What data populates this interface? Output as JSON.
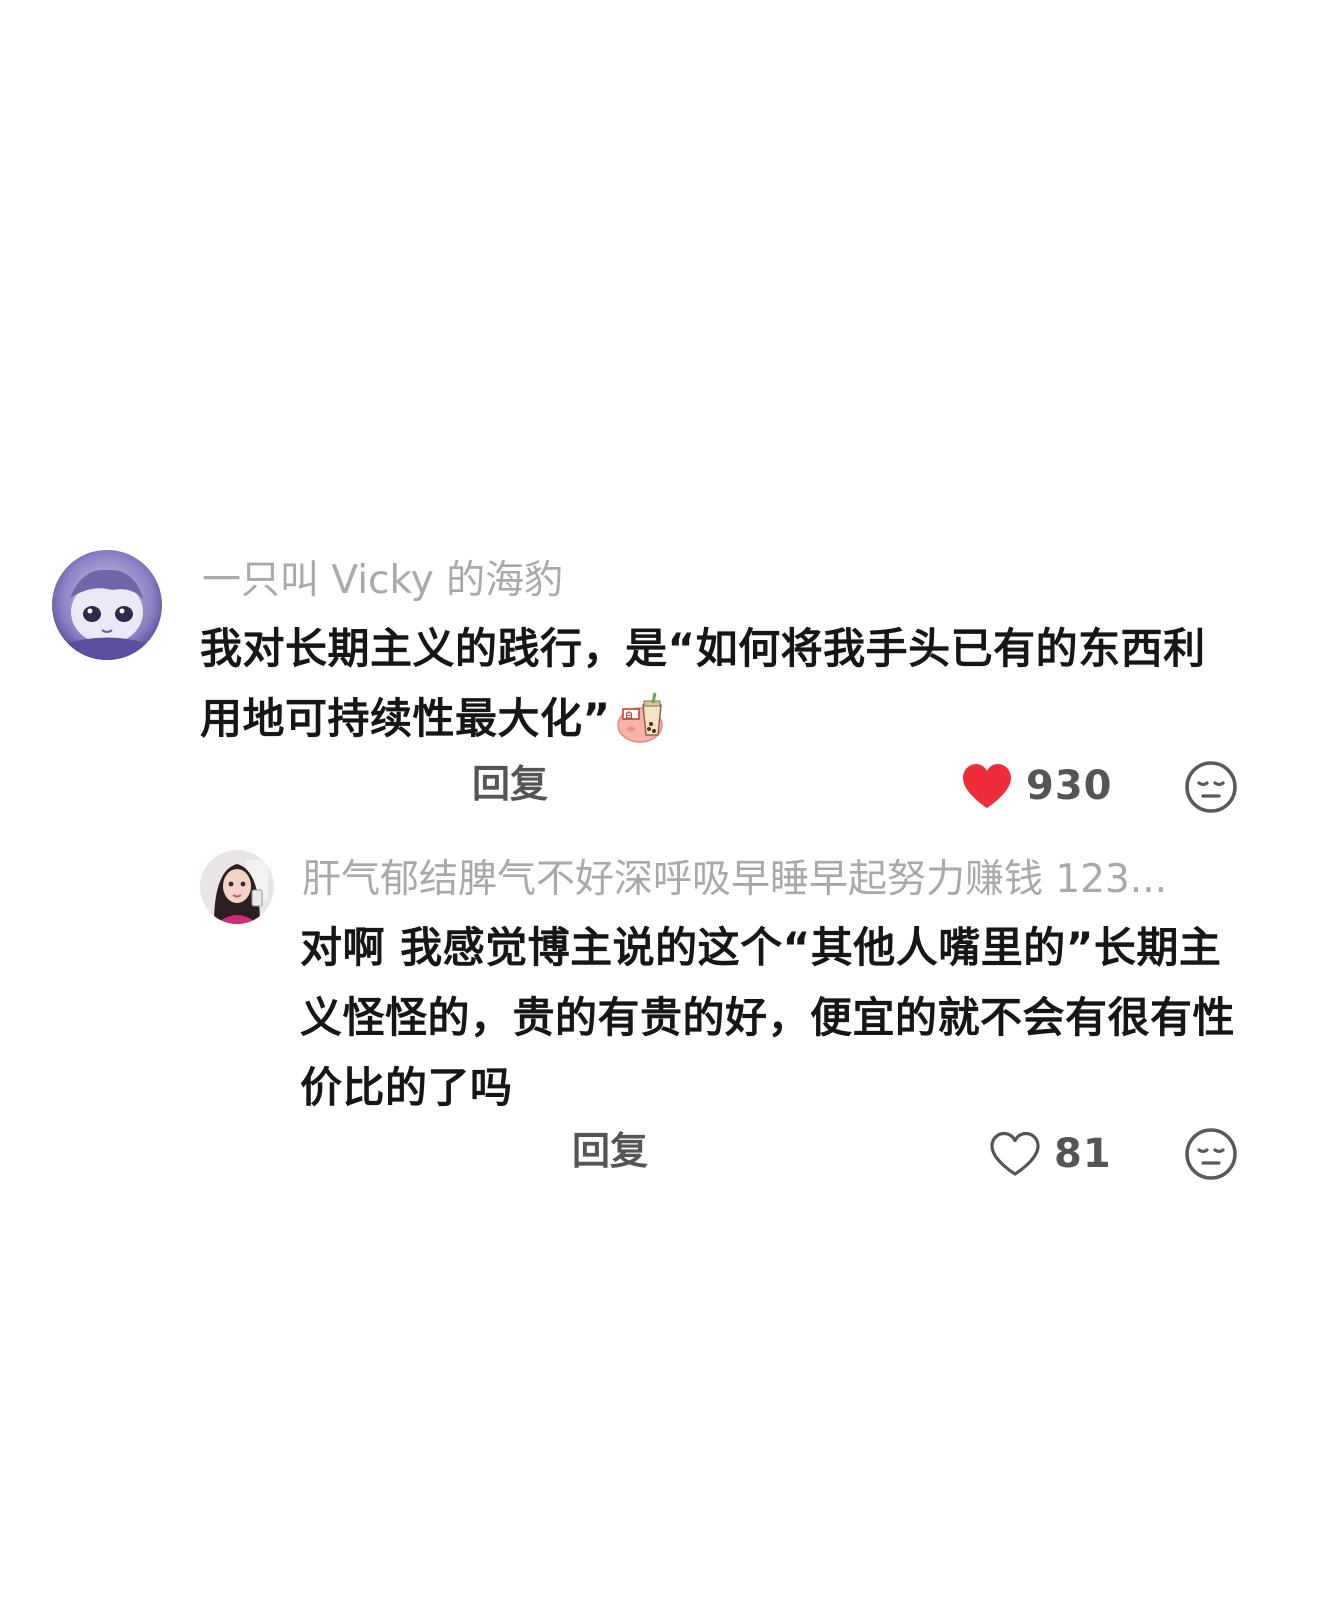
{
  "comments": [
    {
      "username": "一只叫 Vicky 的海豹",
      "text": "我对长期主义的践行，是“如何将我手头已有的东西利用地可持续性最大化”",
      "emoji_icon": "bubble-tea-sticker-icon",
      "reply_label": "回复",
      "likes": "930",
      "liked": true,
      "like_color": "#ef2d3a"
    },
    {
      "username": "肝气郁结脾气不好深呼吸早睡早起努力赚钱 123...",
      "text": "对啊 我感觉博主说的这个“其他人嘴里的”长期主义怪怪的，贵的有贵的好，便宜的就不会有很有性价比的了吗",
      "reply_label": "回复",
      "likes": "81",
      "liked": false
    }
  ]
}
